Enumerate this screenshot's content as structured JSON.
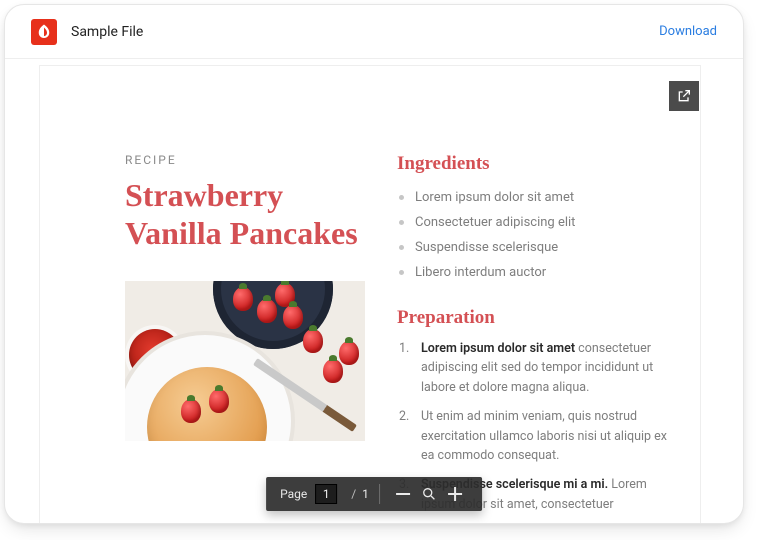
{
  "header": {
    "file_title": "Sample File",
    "download_label": "Download"
  },
  "doc": {
    "eyebrow": "RECIPE",
    "title": "Strawberry Vanilla Pancakes",
    "ingredients_heading": "Ingredients",
    "ingredients": [
      "Lorem ipsum dolor sit amet",
      "Consectetuer adipiscing elit",
      "Suspendisse scelerisque",
      "Libero interdum auctor"
    ],
    "preparation_heading": "Preparation",
    "preparation": [
      {
        "lead": "Lorem ipsum dolor sit amet",
        "rest": " consectetuer adipiscing elit sed do tempor incididunt ut labore et dolore magna aliqua."
      },
      {
        "lead": "",
        "rest": "Ut enim ad minim veniam, quis nostrud exercitation ullamco laboris nisi ut aliquip ex ea commodo consequat."
      },
      {
        "lead": "Suspendisse scelerisque mi a mi.",
        "rest": " Lorem ipsum dolor sit amet, consectetuer"
      }
    ]
  },
  "toolbar": {
    "page_label": "Page",
    "current_page": "1",
    "total_pages": "1"
  }
}
